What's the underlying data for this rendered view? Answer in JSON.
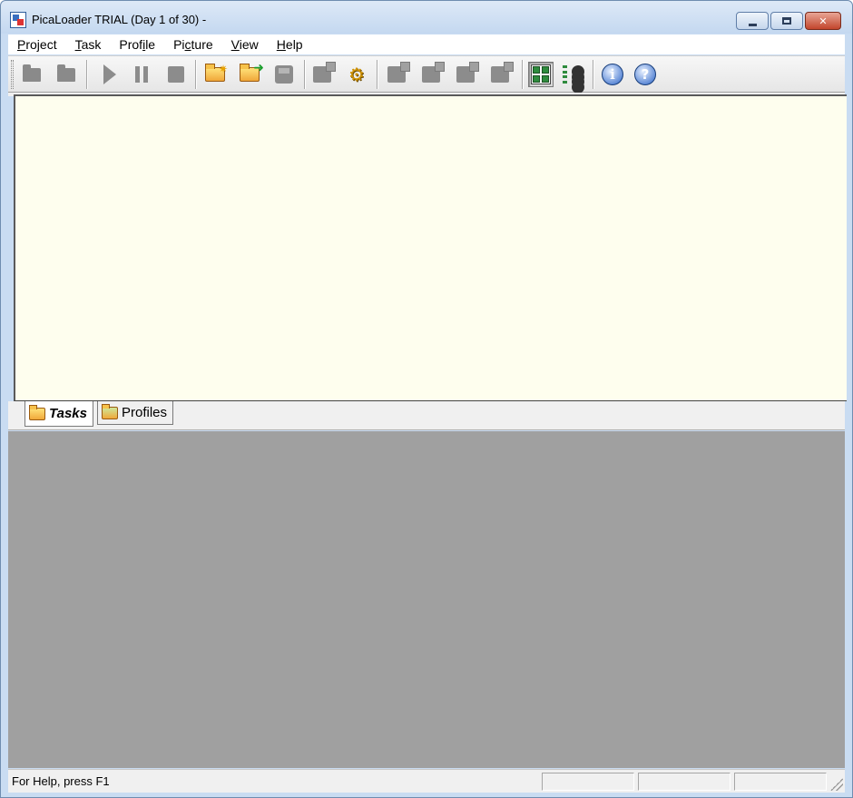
{
  "window": {
    "title": "PicaLoader TRIAL (Day 1 of 30) -",
    "icon": "app-icon",
    "caption_buttons": [
      "minimize",
      "maximize",
      "close"
    ]
  },
  "menubar": {
    "items": [
      {
        "label_acc": "P",
        "label_rest": "roject"
      },
      {
        "label_acc": "T",
        "label_rest": "ask"
      },
      {
        "label_pre": "Prof",
        "label_acc": "i",
        "label_rest": "le"
      },
      {
        "label_pre": "Pi",
        "label_acc": "c",
        "label_rest": "ture"
      },
      {
        "label_acc": "V",
        "label_rest": "iew"
      },
      {
        "label_acc": "H",
        "label_rest": "elp"
      }
    ]
  },
  "toolbar": {
    "buttons": [
      {
        "icon": "new-project-icon",
        "enabled": false
      },
      {
        "icon": "open-project-icon",
        "enabled": false
      },
      {
        "icon": "start-icon",
        "enabled": false
      },
      {
        "icon": "pause-icon",
        "enabled": false
      },
      {
        "icon": "stop-icon",
        "enabled": false
      },
      {
        "icon": "new-task-icon",
        "enabled": true
      },
      {
        "icon": "import-task-icon",
        "enabled": true
      },
      {
        "icon": "save-icon",
        "enabled": false
      },
      {
        "icon": "task-properties-icon",
        "enabled": false
      },
      {
        "icon": "settings-gear-icon",
        "enabled": true
      },
      {
        "icon": "delete-task-icon",
        "enabled": false
      },
      {
        "icon": "copy-task-icon",
        "enabled": false
      },
      {
        "icon": "move-task-icon",
        "enabled": false
      },
      {
        "icon": "export-task-icon",
        "enabled": false
      },
      {
        "icon": "thumbnail-view-icon",
        "enabled": true,
        "pressed": true
      },
      {
        "icon": "list-view-icon",
        "enabled": true
      },
      {
        "icon": "info-icon",
        "enabled": true
      },
      {
        "icon": "help-icon",
        "enabled": true
      }
    ]
  },
  "tabs": [
    {
      "label": "Tasks",
      "active": true,
      "icon": "tasks-folder-icon"
    },
    {
      "label": "Profiles",
      "active": false,
      "icon": "profiles-folder-icon"
    }
  ],
  "statusbar": {
    "text": "For Help, press F1"
  },
  "colors": {
    "task_pane_bg": "#fefeee",
    "bottom_pane_bg": "#a0a0a0",
    "titlebar": "#c9dcf2"
  }
}
